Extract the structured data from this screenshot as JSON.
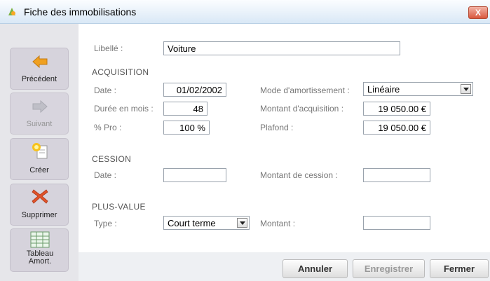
{
  "window": {
    "title": "Fiche des immobilisations",
    "close_label": "X"
  },
  "sidebar": {
    "items": [
      {
        "label": "Précédent",
        "icon": "arrow-left-icon"
      },
      {
        "label": "Suivant",
        "icon": "arrow-right-icon"
      },
      {
        "label": "Créer",
        "icon": "new-document-icon"
      },
      {
        "label": "Supprimer",
        "icon": "delete-icon"
      },
      {
        "label": "Tableau Amort.",
        "icon": "table-icon"
      }
    ]
  },
  "form": {
    "libelle_label": "Libellé :",
    "libelle_value": "Voiture",
    "acquisition": {
      "title": "ACQUISITION",
      "date_label": "Date :",
      "date_value": "01/02/2002",
      "duree_label": "Durée en mois :",
      "duree_value": "48",
      "pro_label": "% Pro :",
      "pro_value": "100 %",
      "mode_label": "Mode d'amortissement :",
      "mode_value": "Linéaire",
      "montant_label": "Montant d'acquisition :",
      "montant_value": "19 050.00 €",
      "plafond_label": "Plafond :",
      "plafond_value": "19 050.00 €"
    },
    "cession": {
      "title": "CESSION",
      "date_label": "Date :",
      "date_value": "",
      "montant_label": "Montant de cession :",
      "montant_value": ""
    },
    "plus_value": {
      "title": "PLUS-VALUE",
      "type_label": "Type :",
      "type_value": "Court terme",
      "montant_label": "Montant :",
      "montant_value": ""
    }
  },
  "buttons": {
    "annuler": "Annuler",
    "enregistrer": "Enregistrer",
    "fermer": "Fermer"
  }
}
